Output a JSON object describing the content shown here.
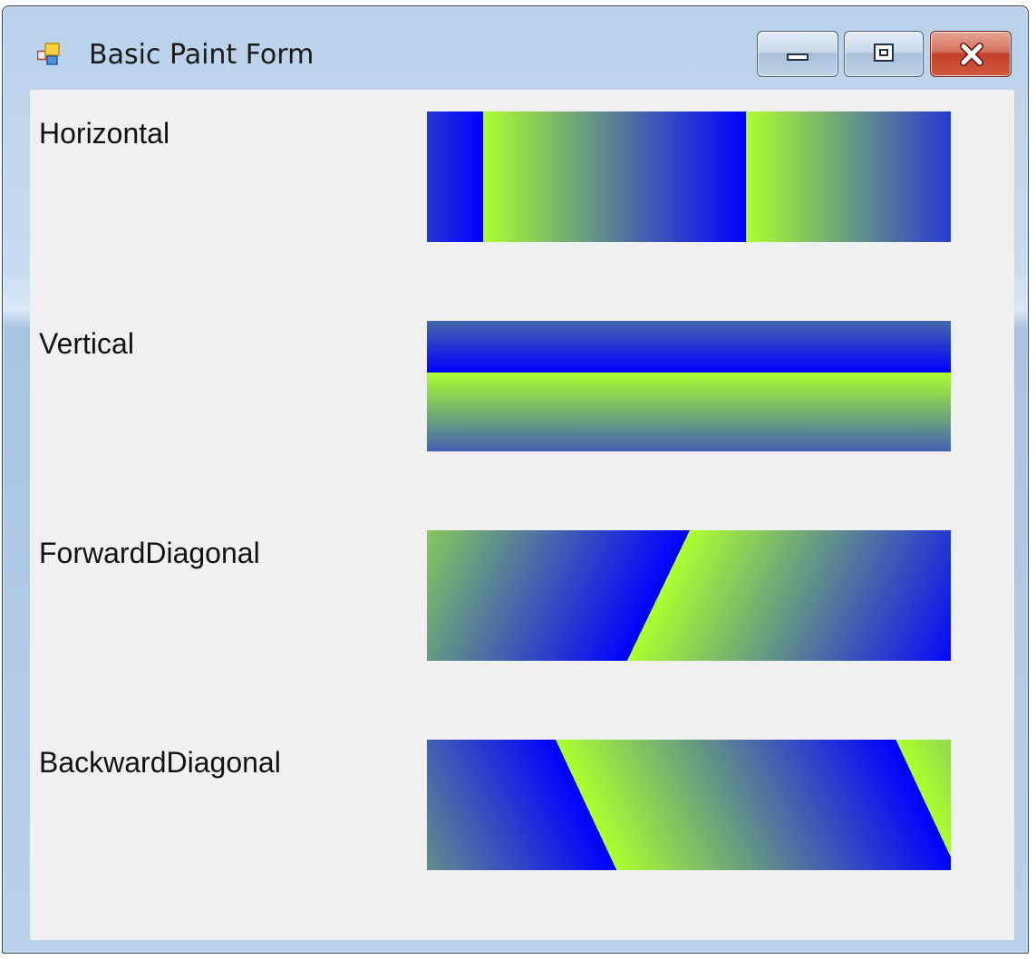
{
  "window": {
    "title": "Basic Paint Form",
    "icon": "winforms-app-icon",
    "buttons": {
      "minimize": "minimize-icon",
      "maximize": "maximize-icon",
      "close": "close-icon"
    }
  },
  "colors": {
    "blue": "#0000ff",
    "green_yellow": "#adff2f",
    "client_background": "#f0f0f0",
    "title_bar": "#b9d1ea",
    "close_button": "#c7432b"
  },
  "gradient_rows": [
    {
      "label": "Horizontal",
      "mode": "Horizontal",
      "start_color": "#0000ff",
      "end_color": "#adff2f"
    },
    {
      "label": "Vertical",
      "mode": "Vertical",
      "start_color": "#0000ff",
      "end_color": "#adff2f"
    },
    {
      "label": "ForwardDiagonal",
      "mode": "ForwardDiagonal",
      "start_color": "#0000ff",
      "end_color": "#adff2f"
    },
    {
      "label": "BackwardDiagonal",
      "mode": "BackwardDiagonal",
      "start_color": "#0000ff",
      "end_color": "#adff2f"
    }
  ]
}
